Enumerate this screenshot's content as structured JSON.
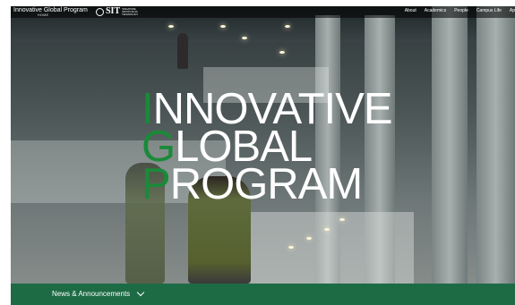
{
  "brand": {
    "title": "Innovative Global Program",
    "home_label": "HOME"
  },
  "logo": {
    "name": "SIT",
    "subtitle": "SINGAPORE INSTITUTE OF TECHNOLOGY"
  },
  "nav": [
    "About",
    "Academics",
    "People",
    "Campus Life",
    "Ap"
  ],
  "hero": {
    "headline_lines": [
      {
        "initial": "I",
        "rest": "NNOVATIVE"
      },
      {
        "initial": "G",
        "rest": "LOBAL"
      },
      {
        "initial": "P",
        "rest": "ROGRAM"
      }
    ]
  },
  "news_bar": {
    "label": "News & Announcements"
  },
  "colors": {
    "accent_green": "#1a8a39",
    "bar_green": "#1d6b45"
  }
}
